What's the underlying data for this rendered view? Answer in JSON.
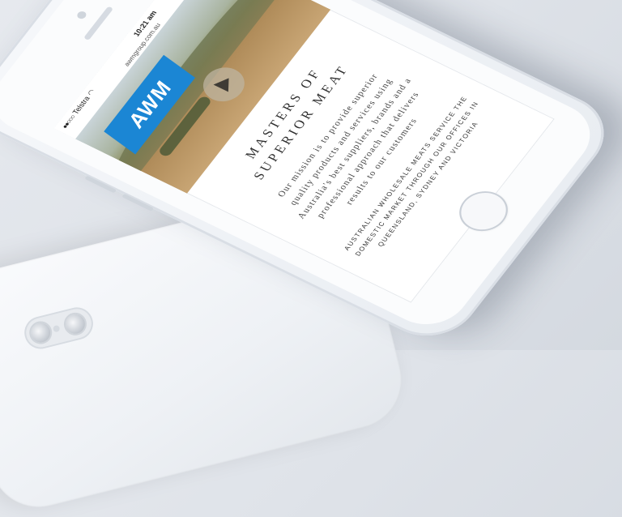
{
  "status": {
    "carrier": "Telstra",
    "time": "10:21 am",
    "url": "awmgroup.com.au"
  },
  "brand": {
    "logo_text": "AWM",
    "accent": "#1b86d4"
  },
  "hero": {
    "play_icon": "play-icon"
  },
  "headline": {
    "line1": "MASTERS OF",
    "line2": "SUPERIOR MEAT"
  },
  "mission": {
    "line1": "Our mission is to provide superior",
    "line2": "quality products and services using",
    "line3": "Australia's best suppliers, brands and a",
    "line4": "professional approach that delivers",
    "line5": "results to our customers"
  },
  "service": {
    "line1": "AUSTRALIAN WHOLESALE MEATS SERVICE THE",
    "line2": "DOMESTIC MARKET THROUGH OUR OFFICES IN",
    "line3": "QUEENSLAND, SYDNEY AND VICTORIA"
  }
}
